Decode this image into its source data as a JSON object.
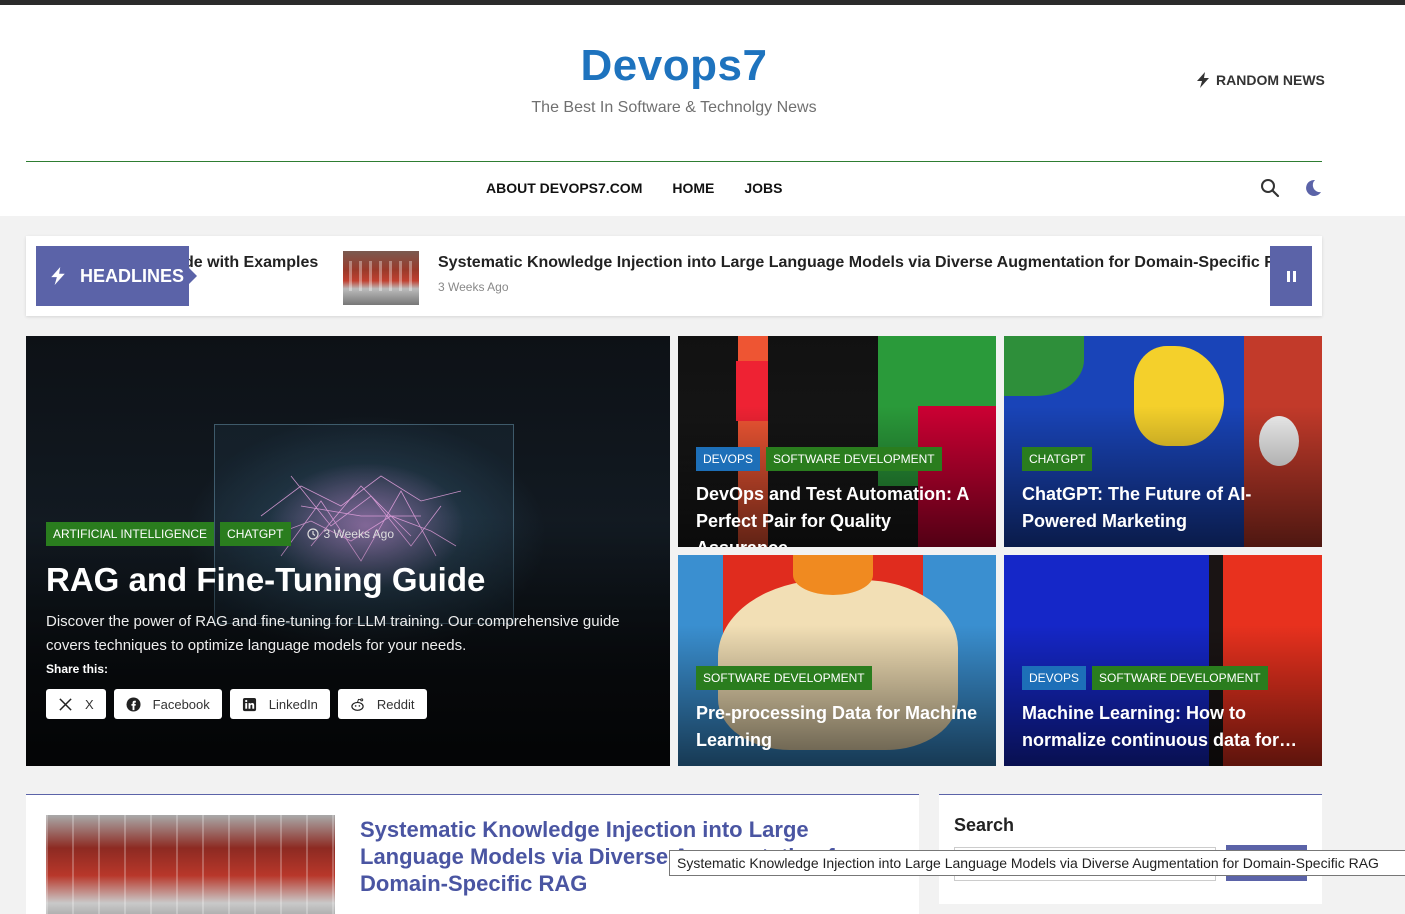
{
  "site": {
    "title": "Devops7",
    "tagline": "The Best In Software & Technolgy News",
    "random_news": "RANDOM NEWS"
  },
  "nav": {
    "items": [
      "ABOUT DEVOPS7.COM",
      "HOME",
      "JOBS"
    ]
  },
  "ticker": {
    "label": "HEADLINES",
    "fragment": "de with Examples",
    "item_title": "Systematic Knowledge Injection into Large Language Models via Diverse Augmentation for Domain-Specific RAG",
    "item_time": "3 Weeks Ago"
  },
  "hero": {
    "categories": [
      "ARTIFICIAL INTELLIGENCE",
      "CHATGPT"
    ],
    "time": "3 Weeks Ago",
    "title": "RAG and Fine-Tuning Guide",
    "excerpt": "Discover the power of RAG and fine-tuning for LLM training. Our comprehensive guide covers techniques to optimize language models for your needs.",
    "share_label": "Share this:",
    "share_buttons": [
      "X",
      "Facebook",
      "LinkedIn",
      "Reddit"
    ]
  },
  "cards": [
    {
      "categories": [
        "DEVOPS",
        "SOFTWARE DEVELOPMENT"
      ],
      "title": "DevOps and Test Automation: A Perfect Pair for Quality Assurance"
    },
    {
      "categories": [
        "CHATGPT"
      ],
      "title": "ChatGPT: The Future of AI-Powered Marketing"
    },
    {
      "categories": [
        "SOFTWARE DEVELOPMENT"
      ],
      "title": "Pre-processing Data for Machine Learning"
    },
    {
      "categories": [
        "DEVOPS",
        "SOFTWARE DEVELOPMENT"
      ],
      "title": "Machine Learning: How to normalize continuous data for…"
    }
  ],
  "post": {
    "title": "Systematic Knowledge Injection into Large Language Models via Diverse Augmentation for Domain-Specific RAG"
  },
  "sidebar": {
    "search_title": "Search"
  },
  "tooltip": "Systematic Knowledge Injection into Large Language Models via Diverse Augmentation for Domain-Specific RAG",
  "colors": {
    "brand_blue": "#1e73be",
    "accent_purple": "#5b63a8",
    "category_green": "#2a7d1e",
    "category_blue": "#1d6fb8"
  }
}
